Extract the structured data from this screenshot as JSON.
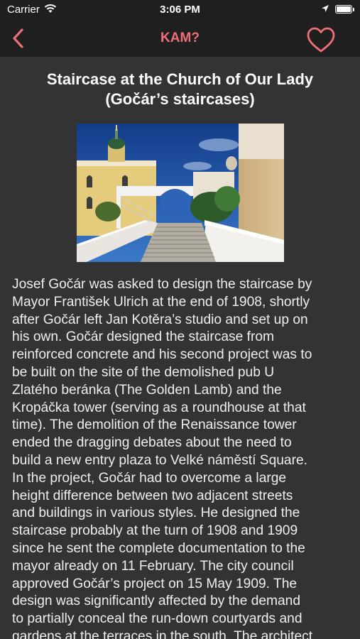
{
  "status_bar": {
    "carrier": "Carrier",
    "time": "3:06 PM"
  },
  "nav": {
    "title": "KAM?",
    "accent_color": "#ef6f78"
  },
  "article": {
    "title_line1": "Staircase at the Church of Our Lady",
    "title_line2": "(Gočár’s staircases)",
    "body_lines": [
      "Josef Gočár was asked to design the staircase by",
      "Mayor František Ulrich at the end of 1908, shortly",
      "after Gočár left Jan Kotěra’s studio and set up on",
      "his own. Gočár designed the staircase from",
      "reinforced concrete and his second project was to",
      "be built on the site of the demolished pub U",
      "Zlatého beránka (The Golden Lamb) and the",
      "Kropáčka tower (serving as a roundhouse at that",
      "time). The demolition of the Renaissance tower",
      "ended the dragging debates about the need to",
      "build a new entry plaza to Velké náměstí Square.",
      "In the project, Gočár had to overcome a large",
      "height difference between two adjacent streets",
      "and buildings in various styles. He designed the",
      "staircase probably at the turn of 1908 and 1909",
      "since he sent the complete documentation to the",
      "mayor already on 11 February. The city council",
      "approved Gočár’s project on 15 May 1909. The",
      "design was significantly affected by the demand",
      "to partially conceal the run-down courtyards and",
      "gardens at the terraces in the south. The architect"
    ]
  }
}
